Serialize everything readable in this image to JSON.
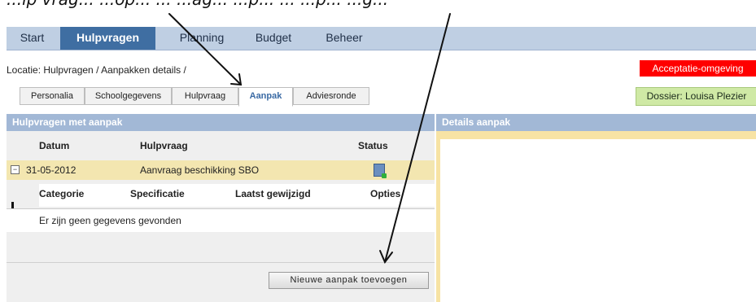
{
  "annotation": {
    "text": "...lp vrag... ...op... ... ...ag... ...p... ... ...p... ...g..."
  },
  "nav": {
    "items": [
      "Start",
      "Hulpvragen",
      "Planning",
      "Budget",
      "Beheer"
    ],
    "active": "Hulpvragen"
  },
  "breadcrumb": "Locatie: Hulpvragen / Aanpakken details /",
  "env_badge": "Acceptatie-omgeving",
  "tabs": [
    "Personalia",
    "Schoolgegevens",
    "Hulpvraag",
    "Aanpak",
    "Adviesronde"
  ],
  "active_tab": "Aanpak",
  "dossier_badge": "Dossier: Louisa Plezier",
  "left_panel": {
    "title": "Hulpvragen met aanpak",
    "columns": [
      "Datum",
      "Hulpvraag",
      "Status"
    ],
    "rows": [
      {
        "datum": "31-05-2012",
        "hulpvraag": "Aanvraag beschikking SBO",
        "status_icon": "document-check-icon"
      }
    ],
    "sub_columns": [
      "Categorie",
      "Specificatie",
      "Laatst gewijzigd",
      "Opties"
    ],
    "empty_message": "Er zijn geen gegevens gevonden",
    "add_button": "Nieuwe aanpak toevoegen"
  },
  "right_panel": {
    "title": "Details aanpak"
  },
  "colors": {
    "nav_bg": "#bfcfe3",
    "nav_active": "#3f6ea2",
    "panel_header": "#a2b8d6",
    "highlight_row": "#f3e6b0",
    "env_badge": "#ff0000",
    "dossier_badge": "#cfe9a5"
  }
}
